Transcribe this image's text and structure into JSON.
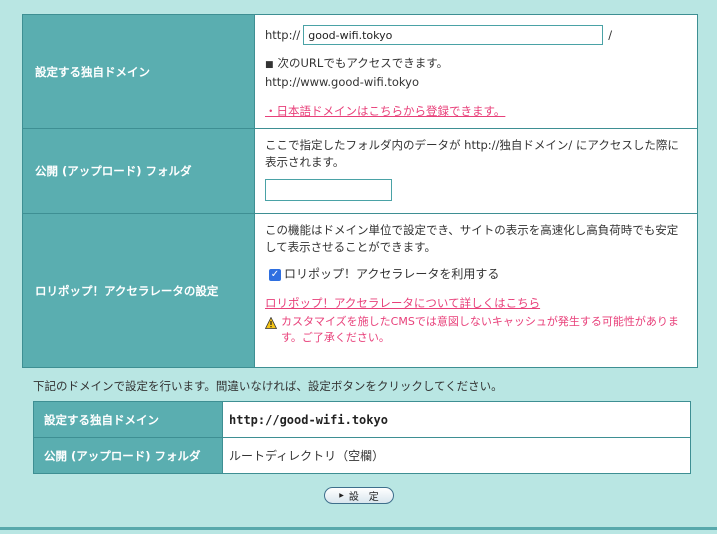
{
  "settings": {
    "domain_row": {
      "label": "設定する独自ドメイン",
      "prefix": "http://",
      "input_value": "good-wifi.tokyo",
      "suffix": "/",
      "bullet": "■",
      "access_note": "次のURLでもアクセスできます。",
      "access_url": "http://www.good-wifi.tokyo",
      "japanese_domain_link": "・日本語ドメインはこちらから登録できます。"
    },
    "folder_row": {
      "label": "公開 (アップロード) フォルダ",
      "description": "ここで指定したフォルダ内のデータが http://独自ドメイン/ にアクセスした際に表示されます。",
      "input_value": ""
    },
    "accelerator_row": {
      "label": "ロリポップ！アクセラレータの設定",
      "description": "この機能はドメイン単位で設定でき、サイトの表示を高速化し高負荷時でも安定して表示させることができます。",
      "checkbox_label": "ロリポップ！アクセラレータを利用する",
      "checkbox_checked": true,
      "details_link": "ロリポップ！アクセラレータについて詳しくはこちら",
      "warning": "カスタマイズを施したCMSでは意図しないキャッシュが発生する可能性があります。ご了承ください。"
    }
  },
  "notice": "下記のドメインで設定を行います。間違いなければ、設定ボタンをクリックしてください。",
  "confirm": {
    "domain_label": "設定する独自ドメイン",
    "domain_value": "http://good-wifi.tokyo",
    "folder_label": "公開 (アップロード) フォルダ",
    "folder_value": "ルートディレクトリ（空欄）"
  },
  "set_button_label": "設　定",
  "icons": {
    "warning": "warning-icon",
    "button_arrow": "triangle-right-icon"
  },
  "colors": {
    "page_bg": "#b9e6e3",
    "header_cell": "#5aaeb0",
    "link_pink": "#e8407a",
    "checkbox": "#2f6fe0"
  }
}
